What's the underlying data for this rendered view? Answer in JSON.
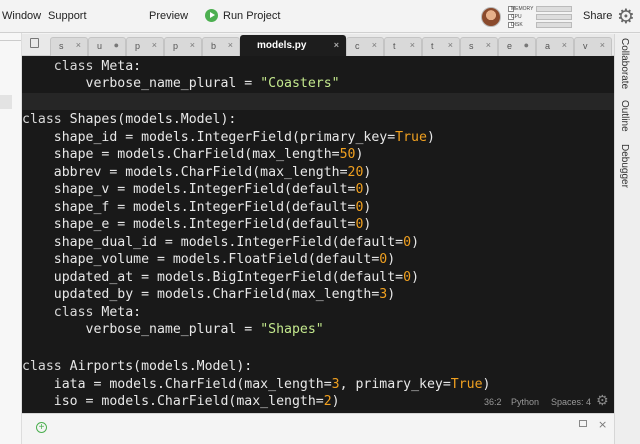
{
  "menubar": {
    "window": "Window",
    "support": "Support",
    "preview": "Preview",
    "run_project": "Run Project",
    "share": "Share",
    "resources": {
      "memory": "MEMORY",
      "cpu": "CPU",
      "disk": "DISK"
    }
  },
  "tabs": [
    {
      "label": "s",
      "close": "×"
    },
    {
      "label": "u",
      "close": "●"
    },
    {
      "label": "p",
      "close": "×"
    },
    {
      "label": "p",
      "close": "×"
    },
    {
      "label": "b",
      "close": "×"
    },
    {
      "label": "models.py",
      "close": "×",
      "active": true
    },
    {
      "label": "c",
      "close": "×"
    },
    {
      "label": "t",
      "close": "×"
    },
    {
      "label": "t",
      "close": "×"
    },
    {
      "label": "s",
      "close": "×"
    },
    {
      "label": "e",
      "close": "●"
    },
    {
      "label": "a",
      "close": "×"
    },
    {
      "label": "v",
      "close": "×"
    }
  ],
  "side_panels": {
    "collaborate": "Collaborate",
    "outline": "Outline",
    "debugger": "Debugger"
  },
  "code": {
    "lines": [
      [
        {
          "t": "    class ",
          "c": "kw"
        },
        {
          "t": "Meta:"
        }
      ],
      [
        {
          "t": "        verbose_name_plural = "
        },
        {
          "t": "\"Coasters\"",
          "c": "str"
        }
      ],
      [
        {
          "t": ""
        }
      ],
      [
        {
          "t": "class ",
          "c": "kw"
        },
        {
          "t": "Shapes(models.Model):"
        }
      ],
      [
        {
          "t": "    shape_id = models.IntegerField(primary_key="
        },
        {
          "t": "True",
          "c": "kwc"
        },
        {
          "t": ")"
        }
      ],
      [
        {
          "t": "    shape = models.CharField(max_length="
        },
        {
          "t": "50",
          "c": "num"
        },
        {
          "t": ")"
        }
      ],
      [
        {
          "t": "    abbrev = models.CharField(max_length="
        },
        {
          "t": "20",
          "c": "num"
        },
        {
          "t": ")"
        }
      ],
      [
        {
          "t": "    shape_v = models.IntegerField(default="
        },
        {
          "t": "0",
          "c": "num"
        },
        {
          "t": ")"
        }
      ],
      [
        {
          "t": "    shape_f = models.IntegerField(default="
        },
        {
          "t": "0",
          "c": "num"
        },
        {
          "t": ")"
        }
      ],
      [
        {
          "t": "    shape_e = models.IntegerField(default="
        },
        {
          "t": "0",
          "c": "num"
        },
        {
          "t": ")"
        }
      ],
      [
        {
          "t": "    shape_dual_id = models.IntegerField(default="
        },
        {
          "t": "0",
          "c": "num"
        },
        {
          "t": ")"
        }
      ],
      [
        {
          "t": "    shape_volume = models.FloatField(default="
        },
        {
          "t": "0",
          "c": "num"
        },
        {
          "t": ")"
        }
      ],
      [
        {
          "t": "    updated_at = models.BigIntegerField(default="
        },
        {
          "t": "0",
          "c": "num"
        },
        {
          "t": ")"
        }
      ],
      [
        {
          "t": "    updated_by = models.CharField(max_length="
        },
        {
          "t": "3",
          "c": "num"
        },
        {
          "t": ")"
        }
      ],
      [
        {
          "t": "    class ",
          "c": "kw"
        },
        {
          "t": "Meta:"
        }
      ],
      [
        {
          "t": "        verbose_name_plural = "
        },
        {
          "t": "\"Shapes\"",
          "c": "str"
        }
      ],
      [
        {
          "t": ""
        }
      ],
      [
        {
          "t": "class ",
          "c": "kw"
        },
        {
          "t": "Airports(models.Model):"
        }
      ],
      [
        {
          "t": "    iata = models.CharField(max_length="
        },
        {
          "t": "3",
          "c": "num"
        },
        {
          "t": ", primary_key="
        },
        {
          "t": "True",
          "c": "kwc"
        },
        {
          "t": ")"
        }
      ],
      [
        {
          "t": "    iso = models.CharField(max_length="
        },
        {
          "t": "2",
          "c": "num"
        },
        {
          "t": ")"
        }
      ]
    ]
  },
  "status": {
    "position": "36:2",
    "language": "Python",
    "spaces": "Spaces: 4"
  },
  "colors": {
    "editor_bg": "#191919",
    "accent": "#4caf50",
    "string": "#c3e88d",
    "number": "#f0a020"
  }
}
